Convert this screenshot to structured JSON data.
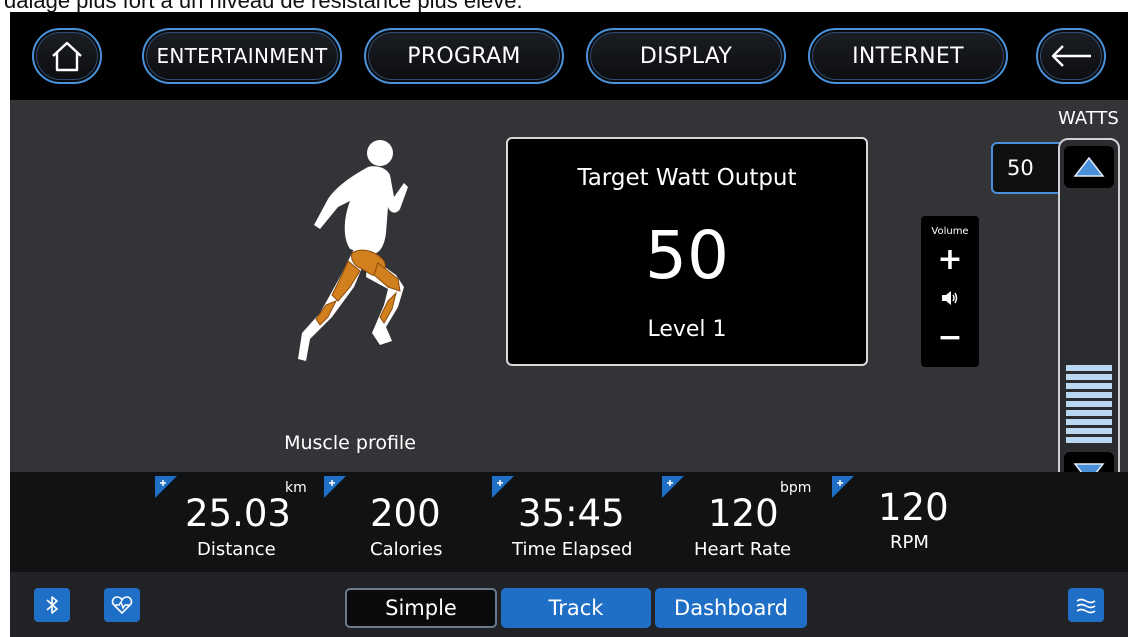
{
  "caption_text": "dalage plus fort à un niveau de résistance plus élevé.",
  "nav": {
    "entertainment": "ENTERTAINMENT",
    "program": "PROGRAM",
    "display": "DISPLAY",
    "internet": "INTERNET"
  },
  "icons": {
    "home": "home-icon",
    "back": "back-arrow-icon",
    "bluetooth": "bluetooth-icon",
    "heart": "heart-rate-icon",
    "menu": "wave-menu-icon",
    "speaker": "speaker-icon"
  },
  "muscle_profile": {
    "label": "Muscle profile"
  },
  "target": {
    "title": "Target Watt Output",
    "value": "50",
    "level": "Level 1"
  },
  "volume": {
    "label": "Volume",
    "plus": "+",
    "minus": "−"
  },
  "watts": {
    "label": "WATTS",
    "value": "50",
    "level_fraction": 0.14
  },
  "stats": [
    {
      "value": "25.03",
      "unit": "km",
      "label": "Distance"
    },
    {
      "value": "200",
      "unit": "",
      "label": "Calories"
    },
    {
      "value": "35:45",
      "unit": "",
      "label": "Time Elapsed"
    },
    {
      "value": "120",
      "unit": "bpm",
      "label": "Heart Rate"
    },
    {
      "value": "120",
      "unit": "",
      "label": "RPM"
    }
  ],
  "views": {
    "simple": "Simple",
    "track": "Track",
    "dashboard": "Dashboard"
  },
  "colors": {
    "accent": "#1f6fc7",
    "nav_border": "#4a90d9",
    "muscle_highlight": "#d2801e",
    "slider_fill": "#b9d7f1"
  }
}
